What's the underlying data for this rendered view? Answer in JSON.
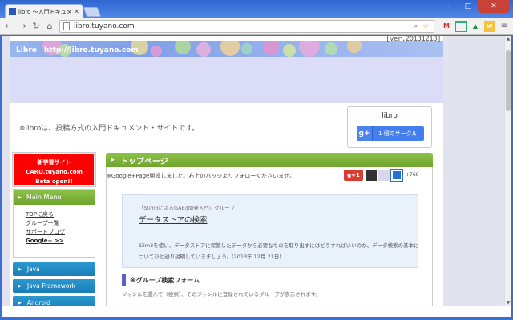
{
  "browser": {
    "tab_title": "libro 〜入門ドキュメント・サ",
    "url": "libro.tuyano.com"
  },
  "page": {
    "version": "[ver.20131218]",
    "banner_title": "Libro　http://libro.tuyano.com",
    "intro": "※libroは、投稿方式の入門ドキュメント・サイトです。",
    "gplus_box": {
      "name": "libro",
      "logo": "g+",
      "circle_count": "1 個のサークル"
    },
    "promo": {
      "line1": "新学習サイト",
      "line2": "CARD.tuyano.com",
      "line3": "Beta open!!"
    },
    "main_menu": {
      "title": "Main Menu",
      "links": [
        "TOPに戻る",
        "グループ一覧",
        "サポートブログ",
        "Google+ >>"
      ]
    },
    "side_buttons": [
      "Java",
      "Java-Framework",
      "Android"
    ],
    "main": {
      "heading": "トップページ",
      "notice": "※Google+Page開設しました。右上のバッジよりフォローくださいませ。",
      "g1_label": "g+1",
      "follow_count": "+766",
      "info": {
        "group": "「Slim3によるGAE/J開発入門」グループ",
        "title": "データストアの検索",
        "desc": "Slim3を使い、データストアに保管したデータから必要なものを取り出すにはどうすればいいのか、データ検索の基本についてひと通り説明していきましょう。(2013年 12月 21日)"
      },
      "section_title": "※グループ検索フォーム",
      "section_text": "ジャンルを選んで〈検索〉、そのジャンルに登録されているグループが表示されます。"
    }
  },
  "colors": {
    "chrome_blue": "#3d6fd3",
    "green_header": "#7bb339",
    "side_blue": "#1f87c1",
    "promo_red": "#ff0000",
    "gplus_blue": "#427fed"
  }
}
